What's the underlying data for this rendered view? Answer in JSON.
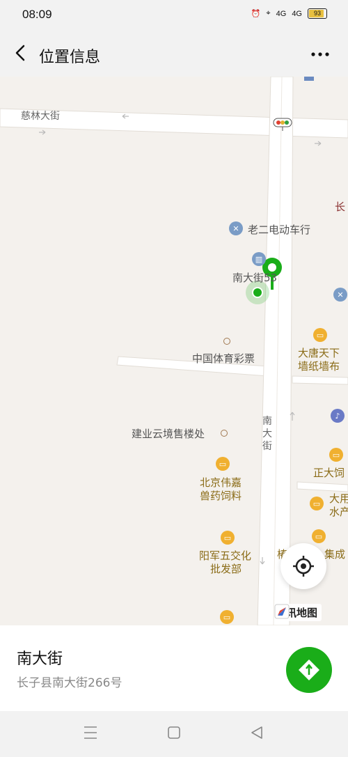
{
  "status_bar": {
    "time": "08:09",
    "signal1": "4G",
    "signal2": "4G",
    "battery": "93"
  },
  "header": {
    "title": "位置信息"
  },
  "map": {
    "labels": {
      "cilin_street": "慈林大街",
      "laoer_shop": "老二电动车行",
      "nandajie_53": "南大街53",
      "lottery": "中国体育彩票",
      "datang_1": "大唐天下",
      "datang_2": "墙纸墙布",
      "nandajie_road_1": "南",
      "nandajie_road_2": "大",
      "nandajie_road_3": "街",
      "jianye": "建业云境售楼处",
      "beijing_1": "北京伟嘉",
      "beijing_2": "兽药饲料",
      "zhengda": "正大饲",
      "dayong_1": "大用",
      "dayong_2": "水产",
      "yangjun_1": "阳军五交化",
      "yangjun_2": "批发部",
      "jicheng": "集成",
      "edge_char": "长",
      "edge_char2": "樁"
    },
    "attribution": "腾讯地图",
    "colors": {
      "pin_green": "#1aad19",
      "road": "#ffffff",
      "block": "#f4f1ed",
      "poi_orange": "#f0b030",
      "poi_blue": "#7a9cc6"
    }
  },
  "place": {
    "name": "南大街",
    "address": "长子县南大街266号"
  },
  "icons": [
    "back-icon",
    "more-icon",
    "locate-icon",
    "navigate-icon",
    "menu-icon",
    "home-icon",
    "back-triangle-icon"
  ]
}
